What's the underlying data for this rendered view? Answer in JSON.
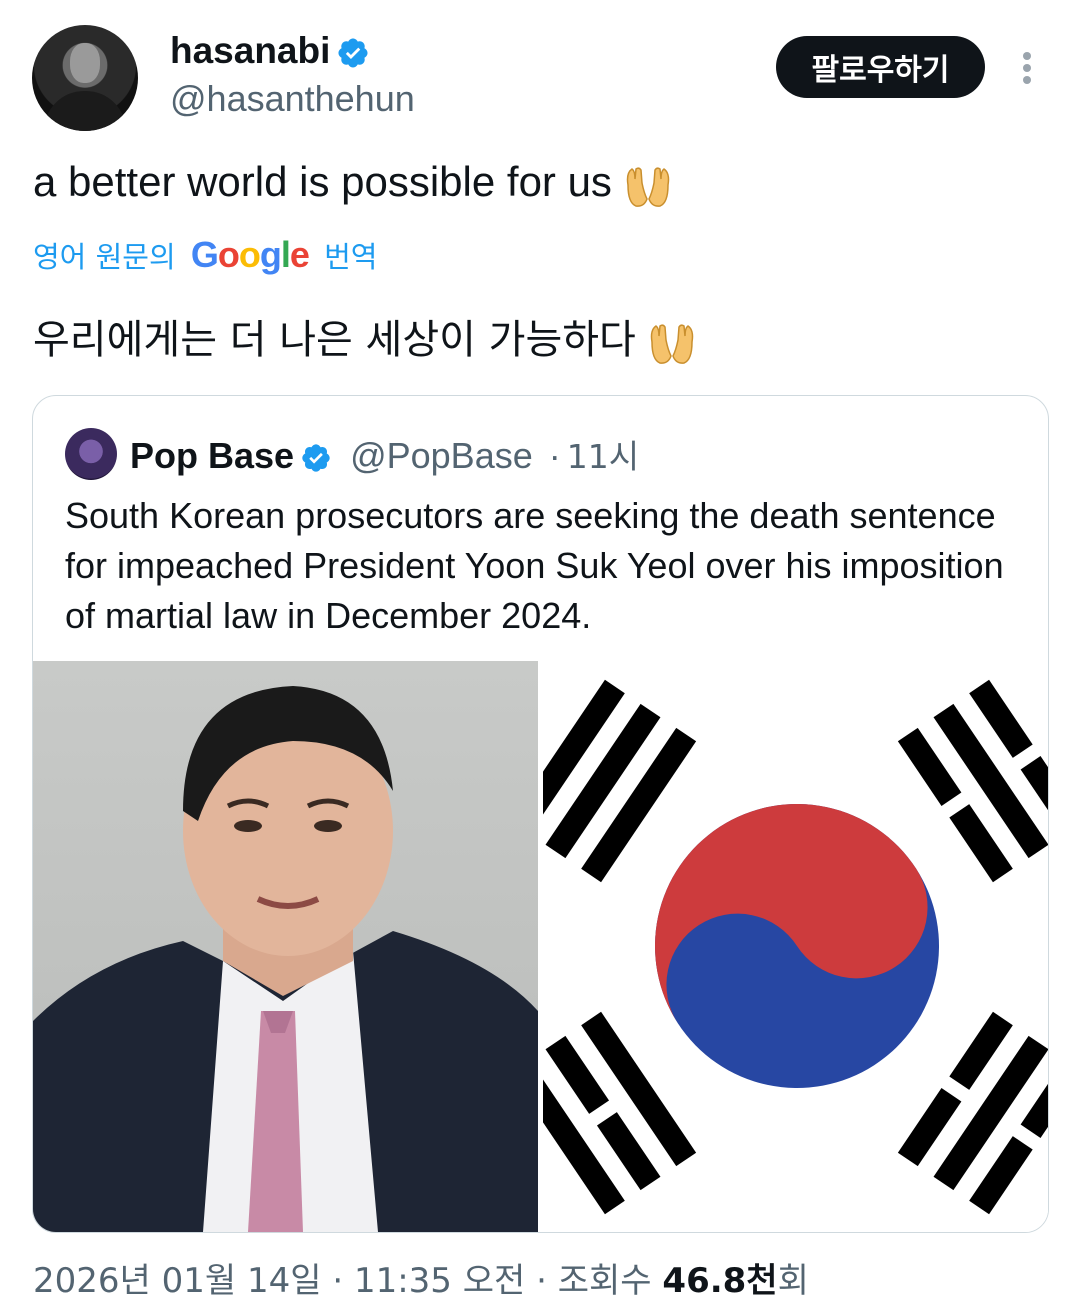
{
  "author": {
    "name": "hasanabi",
    "handle": "@hasanthehun",
    "verified": true
  },
  "actions": {
    "follow_label": "팔로우하기"
  },
  "tweet": {
    "text": "a better world is possible for us",
    "emoji": "palms-up-together-icon"
  },
  "translation": {
    "prefix": "영어 원문의",
    "google_letters": [
      "G",
      "o",
      "o",
      "g",
      "l",
      "e"
    ],
    "suffix": "번역",
    "text": "우리에게는 더 나은 세상이 가능하다"
  },
  "quote": {
    "name": "Pop Base",
    "handle": "@PopBase",
    "separator": "·",
    "time": "11시",
    "verified": true,
    "text": "South Korean prosecutors are seeking the death sentence for impeached President Yoon Suk Yeol over his imposition of martial law in December 2024."
  },
  "meta": {
    "date": "2026년 01월 14일",
    "sep1": "·",
    "time": "11:35 오전",
    "sep2": "·",
    "views_label": "조회수",
    "views_value": "46.8천",
    "views_suffix": "회"
  },
  "colors": {
    "accent": "#1d9bf0",
    "text": "#0f1419",
    "secondary": "#536471",
    "flag_red": "#cd3b3d",
    "flag_blue": "#2747a3"
  }
}
